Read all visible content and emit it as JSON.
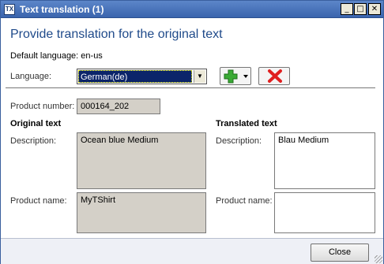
{
  "window": {
    "title": "Text translation (1)",
    "icon_glyph": "TX",
    "minimize_glyph": "_",
    "maximize_glyph": "□",
    "close_glyph": "✕"
  },
  "heading": "Provide translation for the original text",
  "default_language": "Default language: en-us",
  "language": {
    "label": "Language:",
    "selected": "German(de)",
    "dropdown_glyph": "▼"
  },
  "toolbar": {
    "add_icon": "plus-icon",
    "add_dropdown_glyph": "▾",
    "delete_icon": "delete-x-icon",
    "add_color": "#3aaa35",
    "delete_color": "#e02020"
  },
  "product_number": {
    "label": "Product number:",
    "value": "000164_202"
  },
  "original": {
    "header": "Original text",
    "description_label": "Description:",
    "description_value": "Ocean blue Medium",
    "product_name_label": "Product name:",
    "product_name_value": "MyTShirt"
  },
  "translated": {
    "header": "Translated text",
    "description_label": "Description:",
    "description_value": "Blau Medium",
    "product_name_label": "Product name:",
    "product_name_value": ""
  },
  "footer": {
    "close_label": "Close"
  }
}
